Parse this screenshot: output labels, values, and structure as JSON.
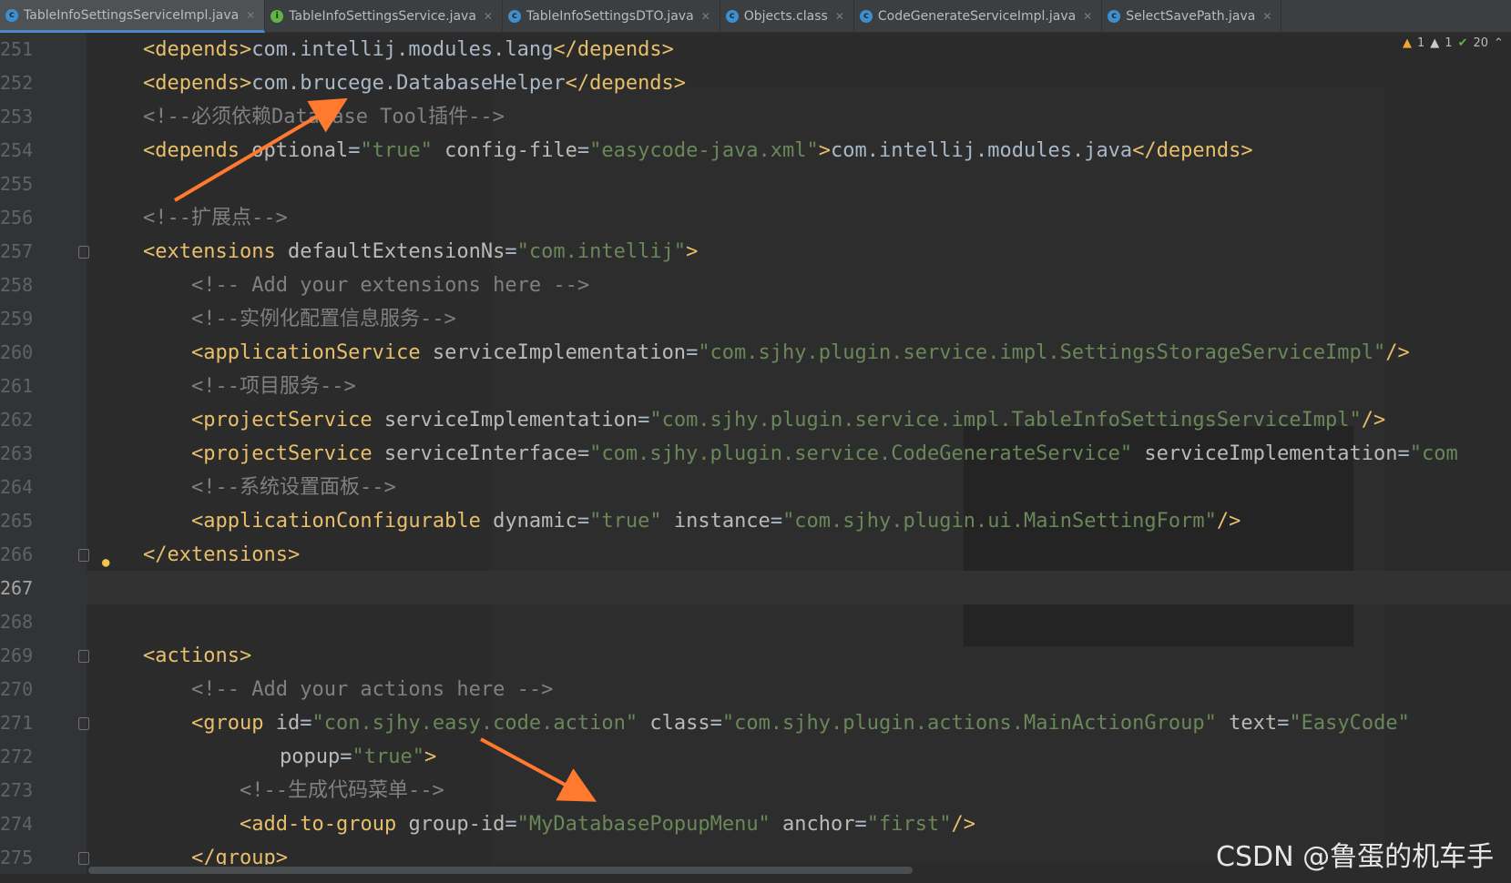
{
  "tabs": [
    {
      "label": "TableInfoSettingsServiceImpl.java",
      "icon": "class-icon"
    },
    {
      "label": "TableInfoSettingsService.java",
      "icon": "interface-icon"
    },
    {
      "label": "TableInfoSettingsDTO.java",
      "icon": "class-icon"
    },
    {
      "label": "Objects.class",
      "icon": "class-icon"
    },
    {
      "label": "CodeGenerateServiceImpl.java",
      "icon": "class-icon"
    },
    {
      "label": "SelectSavePath.java",
      "icon": "class-icon"
    }
  ],
  "status": {
    "warnings": "1",
    "weak_warnings": "1",
    "checks": "20"
  },
  "watermark": "CSDN @鲁蛋的机车手",
  "line_numbers": [
    "251",
    "252",
    "253",
    "254",
    "255",
    "256",
    "257",
    "258",
    "259",
    "260",
    "261",
    "262",
    "263",
    "264",
    "265",
    "266",
    "267",
    "268",
    "269",
    "270",
    "271",
    "272",
    "273",
    "274",
    "275"
  ],
  "current_line": "267",
  "code": {
    "l251": {
      "t1": "<depends>",
      "v": "com.intellij.modules.lang",
      "t2": "</depends>"
    },
    "l252": {
      "t1": "<depends>",
      "v": "com.brucege.DatabaseHelper",
      "t2": "</depends>"
    },
    "l253": "<!--必须依赖Database Tool插件-->",
    "l254": {
      "t1": "<depends ",
      "a1": "optional",
      "eq1": "=",
      "s1": "\"true\"",
      "a2": " config-file",
      "eq2": "=",
      "s2": "\"easycode-java.xml\"",
      "gt": ">",
      "v": "com.intellij.modules.java",
      "t2": "</depends>"
    },
    "l256": "<!--扩展点-->",
    "l257": {
      "t1": "<extensions ",
      "a1": "defaultExtensionNs",
      "eq": "=",
      "s1": "\"com.intellij\"",
      "gt": ">"
    },
    "l258": "<!-- Add your extensions here -->",
    "l259": "<!--实例化配置信息服务-->",
    "l260": {
      "t1": "<applicationService ",
      "a1": "serviceImplementation",
      "eq": "=",
      "s1": "\"com.sjhy.plugin.service.impl.SettingsStorageServiceImpl\"",
      "end": "/>"
    },
    "l261": "<!--项目服务-->",
    "l262": {
      "t1": "<projectService ",
      "a1": "serviceImplementation",
      "eq": "=",
      "s1": "\"com.sjhy.plugin.service.impl.TableInfoSettingsServiceImpl\"",
      "end": "/>"
    },
    "l263": {
      "t1": "<projectService ",
      "a1": "serviceInterface",
      "eq": "=",
      "s1": "\"com.sjhy.plugin.service.CodeGenerateService\"",
      "a2": " serviceImplementation",
      "eq2": "=",
      "s2": "\"com"
    },
    "l264": "<!--系统设置面板-->",
    "l265": {
      "t1": "<applicationConfigurable ",
      "a1": "dynamic",
      "eq1": "=",
      "s1": "\"true\"",
      "a2": " instance",
      "eq2": "=",
      "s2": "\"com.sjhy.plugin.ui.MainSettingForm\"",
      "end": "/>"
    },
    "l266": "</extensions>",
    "l269": "<actions>",
    "l270": "<!-- Add your actions here -->",
    "l271": {
      "t1": "<group ",
      "a1": "id",
      "eq1": "=",
      "s1": "\"con.sjhy.easy.code.action\"",
      "a2": " class",
      "eq2": "=",
      "s2": "\"com.sjhy.plugin.actions.MainActionGroup\"",
      "a3": " text",
      "eq3": "=",
      "s3": "\"EasyCode\""
    },
    "l272": {
      "a1": "popup",
      "eq1": "=",
      "s1": "\"true\"",
      "gt": ">"
    },
    "l273": "<!--生成代码菜单-->",
    "l274": {
      "t1": "<add-to-group ",
      "a1": "group-id",
      "eq1": "=",
      "s1": "\"MyDatabasePopupMenu\"",
      "a2": " anchor",
      "eq2": "=",
      "s2": "\"first\"",
      "end": "/>"
    },
    "l275": "</group>"
  },
  "colors": {
    "tag": "#e8bf6a",
    "attr": "#bababa",
    "string": "#6a8759",
    "comment": "#808080",
    "arrow": "#ff7a2e"
  }
}
